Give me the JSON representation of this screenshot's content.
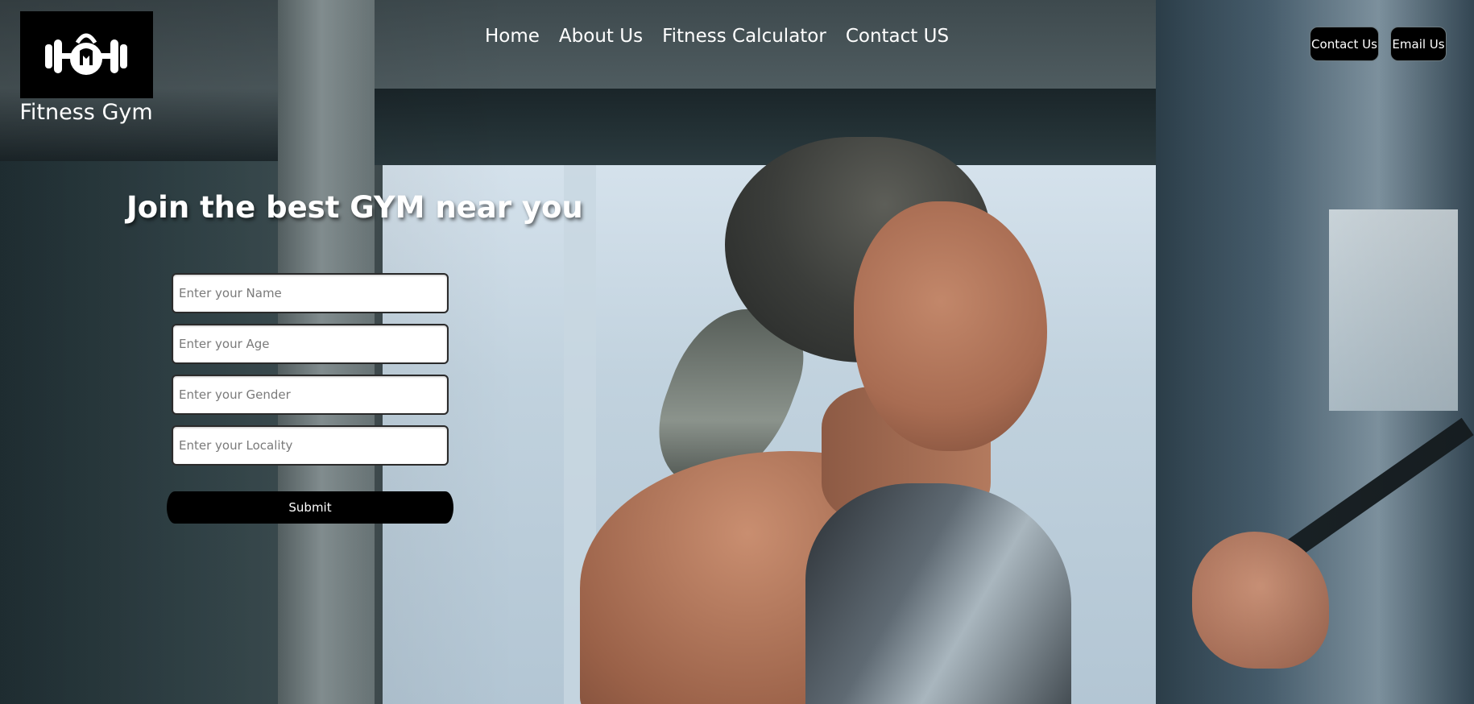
{
  "brand": {
    "logo_icon": "kettlebell-dumbbell-icon",
    "name": "Fitness Gym"
  },
  "nav": {
    "items": [
      {
        "label": "Home"
      },
      {
        "label": "About Us"
      },
      {
        "label": "Fitness Calculator"
      },
      {
        "label": "Contact US"
      }
    ]
  },
  "header_buttons": {
    "contact_label": "Contact Us",
    "email_label": "Email Us"
  },
  "hero": {
    "title": "Join the best GYM near you"
  },
  "form": {
    "name_placeholder": "Enter your Name",
    "age_placeholder": "Enter your Age",
    "gender_placeholder": "Enter your Gender",
    "locality_placeholder": "Enter your Locality",
    "submit_label": "Submit"
  },
  "colors": {
    "button_bg": "#000000",
    "text": "#ffffff"
  }
}
